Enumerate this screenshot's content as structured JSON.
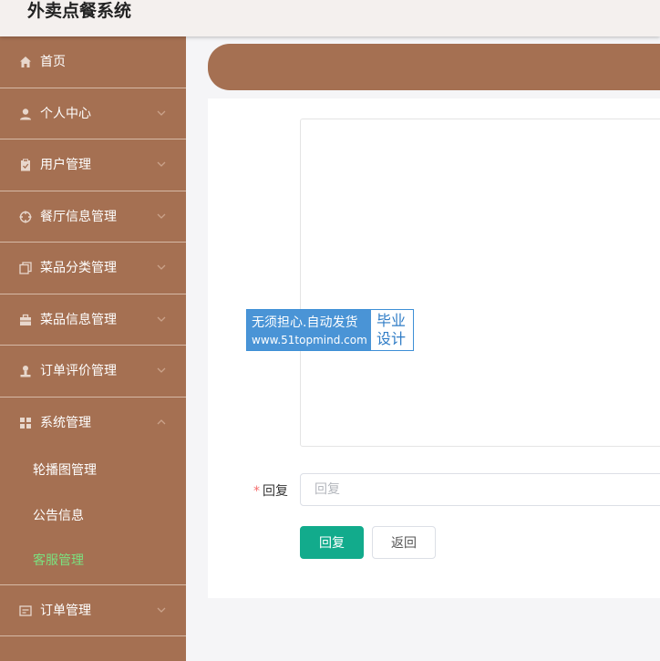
{
  "app": {
    "title": "外卖点餐系统"
  },
  "sidebar": {
    "items": [
      {
        "label": "首页",
        "icon": "home-icon"
      },
      {
        "label": "个人中心",
        "icon": "user-icon"
      },
      {
        "label": "用户管理",
        "icon": "clipboard-icon"
      },
      {
        "label": "餐厅信息管理",
        "icon": "target-icon"
      },
      {
        "label": "菜品分类管理",
        "icon": "copy-icon"
      },
      {
        "label": "菜品信息管理",
        "icon": "briefcase-icon"
      },
      {
        "label": "订单评价管理",
        "icon": "person-icon"
      },
      {
        "label": "系统管理",
        "icon": "grid-icon"
      },
      {
        "label": "订单管理",
        "icon": "card-icon"
      }
    ],
    "submenu": [
      {
        "label": "轮播图管理"
      },
      {
        "label": "公告信息"
      },
      {
        "label": "客服管理"
      }
    ],
    "active_color": "#7be07f",
    "bg_color": "#a57052"
  },
  "form": {
    "reply_label": "回复",
    "required_mark": "*",
    "reply_placeholder": "回复",
    "reply_value": ""
  },
  "buttons": {
    "submit_label": "回复",
    "back_label": "返回"
  },
  "watermark": {
    "line1": "无须担心.自动发货",
    "line2": "www.51topmind.com",
    "side": "毕业设计"
  },
  "colors": {
    "accent": "#12ab8c",
    "brand": "#a57052"
  }
}
